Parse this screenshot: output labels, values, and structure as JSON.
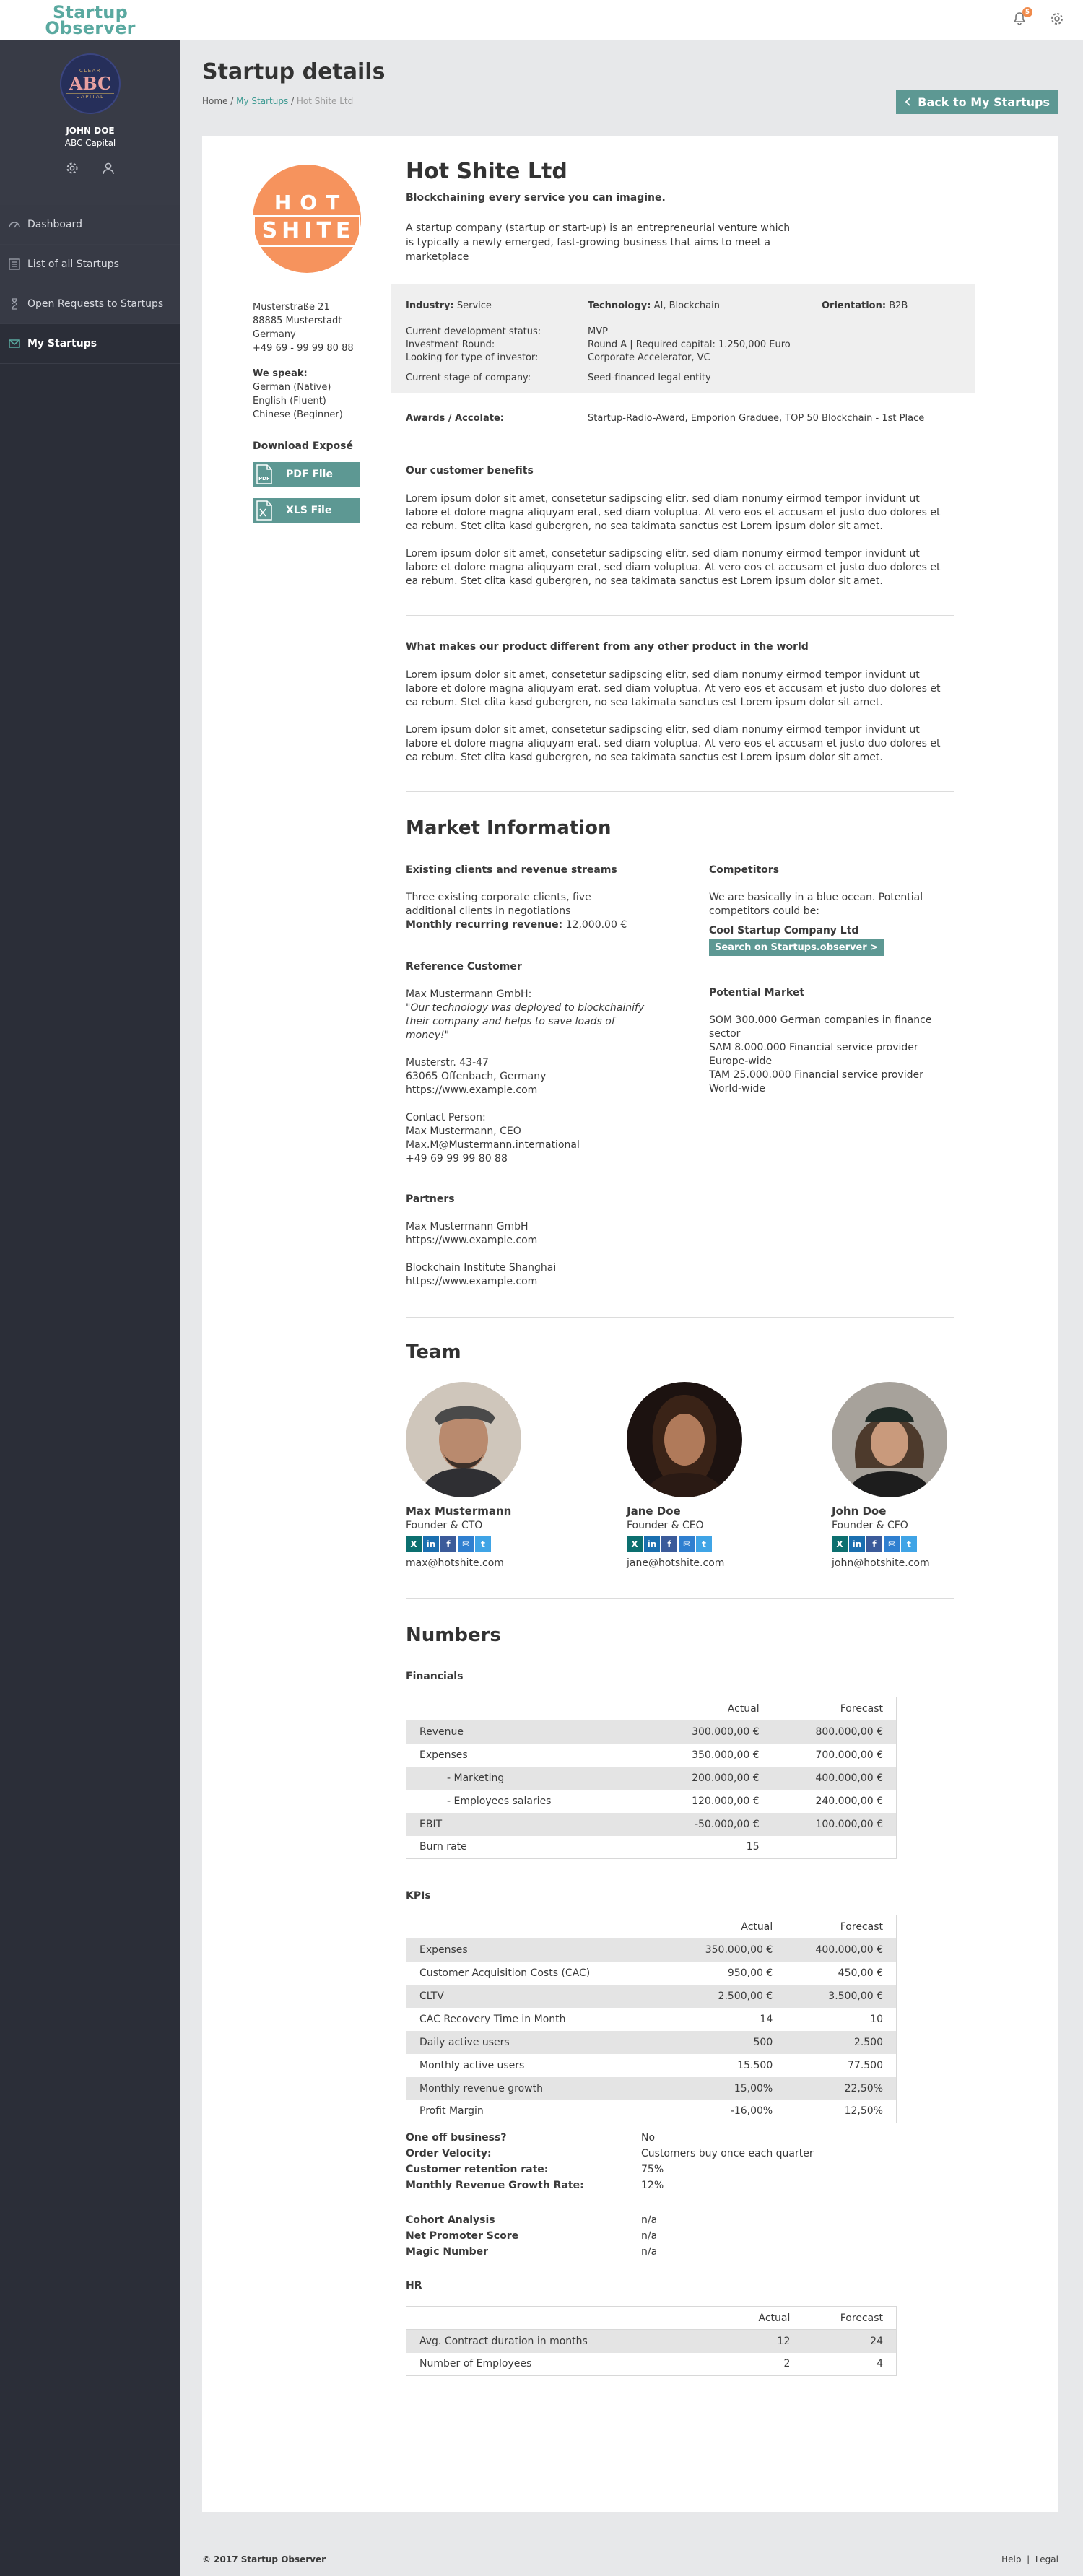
{
  "brand": {
    "line1": "Startup",
    "line2": "Observer"
  },
  "notifications": {
    "count": "5"
  },
  "profile": {
    "logo_top": "CLEAR",
    "logo_main": "ABC",
    "logo_bottom": "CAPITAL",
    "name": "JOHN DOE",
    "company": "ABC Capital"
  },
  "nav": [
    {
      "label": "Dashboard",
      "icon": "gauge-icon"
    },
    {
      "label": "List of all Startups",
      "icon": "list-icon"
    },
    {
      "label": "Open Requests to Startups",
      "icon": "hourglass-icon"
    },
    {
      "label": "My Startups",
      "icon": "envelope-icon"
    }
  ],
  "page": {
    "title": "Startup details",
    "back_label": "Back to My Startups"
  },
  "breadcrumb": {
    "home": "Home",
    "sep": "/",
    "mine": "My Startups",
    "current": "Hot Shite Ltd"
  },
  "company": {
    "logo_line1": "HOT",
    "logo_line2": "SHITE",
    "name": "Hot Shite Ltd",
    "tagline": "Blockchaining every service you can imagine.",
    "description": "A startup company (startup or start-up) is an entrepreneurial venture which is typically a newly emerged, fast-growing business that aims to meet a marketplace",
    "address": [
      "Musterstraße 21",
      "88885 Musterstadt",
      "Germany",
      "+49 69 - 99 99 80 88"
    ],
    "speak_label": "We speak:",
    "languages": [
      "German (Native)",
      "English (Fluent)",
      "Chinese (Beginner)"
    ],
    "download_title": "Download Exposé",
    "pdf_label": "PDF File",
    "xls_label": "XLS File"
  },
  "facts": {
    "industry_label": "Industry:",
    "industry": "Service",
    "technology_label": "Technology:",
    "technology": "AI, Blockchain",
    "orientation_label": "Orientation:",
    "orientation": "B2B",
    "dev_status_label": "Current development status:",
    "dev_status": "MVP",
    "investment_label": "Investment Round:",
    "investment": "Round A | Required capital: 1.250,000 Euro",
    "investor_label": "Looking for type of investor:",
    "investor": "Corporate Accelerator, VC",
    "stage_label": "Current stage of company:",
    "stage": "Seed-financed legal entity",
    "awards_label": "Awards / Accolate:",
    "awards": "Startup-Radio-Award, Emporion Graduee, TOP 50 Blockchain - 1st Place"
  },
  "benefits": {
    "title": "Our customer benefits",
    "p1": "Lorem ipsum dolor sit amet, consetetur sadipscing elitr, sed diam nonumy eirmod tempor invidunt ut labore et dolore magna aliquyam erat, sed diam voluptua. At vero eos et accusam et justo duo dolores et ea rebum. Stet clita kasd gubergren, no sea takimata sanctus est Lorem ipsum dolor sit amet.",
    "p2": "Lorem ipsum dolor sit amet, consetetur sadipscing elitr, sed diam nonumy eirmod tempor invidunt ut labore et dolore magna aliquyam erat, sed diam voluptua. At vero eos et accusam et justo duo dolores et ea rebum. Stet clita kasd gubergren, no sea takimata sanctus est Lorem ipsum dolor sit amet."
  },
  "difference": {
    "title": "What makes our product different from any other product in the world",
    "p1": "Lorem ipsum dolor sit amet, consetetur sadipscing elitr, sed diam nonumy eirmod tempor invidunt ut labore et dolore magna aliquyam erat, sed diam voluptua. At vero eos et accusam et justo duo dolores et ea rebum. Stet clita kasd gubergren, no sea takimata sanctus est Lorem ipsum dolor sit amet.",
    "p2": "Lorem ipsum dolor sit amet, consetetur sadipscing elitr, sed diam nonumy eirmod tempor invidunt ut labore et dolore magna aliquyam erat, sed diam voluptua. At vero eos et accusam et justo duo dolores et ea rebum. Stet clita kasd gubergren, no sea takimata sanctus est Lorem ipsum dolor sit amet."
  },
  "market": {
    "title": "Market Information",
    "clients_title": "Existing clients and revenue streams",
    "clients_text": "Three existing corporate clients, five additional clients in negotiations",
    "mrr_label": "Monthly recurring revenue:",
    "mrr": "12,000.00 €",
    "ref_title": "Reference Customer",
    "ref_company": "Max Mustermann GmbH:",
    "ref_quote": "\"Our technology was deployed to blockchainify their company and helps to save loads of money!\"",
    "ref_street": "Musterstr. 43-47",
    "ref_city": "63065 Offenbach, Germany",
    "ref_url": "https://www.example.com",
    "contact_label": "Contact Person:",
    "contact_name": "Max Mustermann, CEO",
    "contact_email": "Max.M@Mustermann.international",
    "contact_phone": "+49 69 99 99 80 88",
    "partners_title": "Partners",
    "partner1_name": "Max Mustermann GmbH",
    "partner1_url": "https://www.example.com",
    "partner2_name": "Blockchain Institute Shanghai",
    "partner2_url": "https://www.example.com",
    "competitors_title": "Competitors",
    "competitors_text": "We are basically in a blue ocean. Potential competitors could be:",
    "competitor1": "Cool Startup Company Ltd",
    "search_label": "Search on Startups.observer >",
    "potential_title": "Potential Market",
    "som": "SOM 300.000 German companies in finance sector",
    "sam": "SAM 8.000.000 Financial service provider Europe-wide",
    "tam": "TAM 25.000.000 Financial service provider World-wide"
  },
  "team": {
    "title": "Team",
    "members": [
      {
        "name": "Max Mustermann",
        "role": "Founder & CTO",
        "email": "max@hotshite.com"
      },
      {
        "name": "Jane Doe",
        "role": "Founder & CEO",
        "email": "jane@hotshite.com"
      },
      {
        "name": "John Doe",
        "role": "Founder & CFO",
        "email": "john@hotshite.com"
      }
    ]
  },
  "numbers": {
    "title": "Numbers",
    "col_actual": "Actual",
    "col_forecast": "Forecast",
    "financials_title": "Financials",
    "financials": [
      [
        "Revenue",
        "300.000,00 €",
        "800.000,00 €"
      ],
      [
        "Expenses",
        "350.000,00 €",
        "700.000,00 €"
      ],
      [
        "- Marketing",
        "200.000,00 €",
        "400.000,00 €"
      ],
      [
        "- Employees salaries",
        "120.000,00 €",
        "240.000,00 €"
      ],
      [
        "EBIT",
        "-50.000,00 €",
        "100.000,00 €"
      ],
      [
        "Burn rate",
        "15",
        ""
      ]
    ],
    "kpis_title": "KPIs",
    "kpis": [
      [
        "Expenses",
        "350.000,00 €",
        "400.000,00 €"
      ],
      [
        "Customer Acquisition Costs (CAC)",
        "950,00 €",
        "450,00 €"
      ],
      [
        "CLTV",
        "2.500,00 €",
        "3.500,00 €"
      ],
      [
        "CAC Recovery Time in Month",
        "14",
        "10"
      ],
      [
        "Daily active users",
        "500",
        "2.500"
      ],
      [
        "Monthly active users",
        "15.500",
        "77.500"
      ],
      [
        "Monthly revenue growth",
        "15,00%",
        "22,50%"
      ],
      [
        "Profit Margin",
        "-16,00%",
        "12,50%"
      ]
    ],
    "kv1": [
      [
        "One off business?",
        "No"
      ],
      [
        "Order Velocity:",
        "Customers buy once each quarter"
      ],
      [
        "Customer retention rate:",
        "75%"
      ],
      [
        "Monthly Revenue Growth Rate:",
        "12%"
      ]
    ],
    "kv2": [
      [
        "Cohort Analysis",
        "n/a"
      ],
      [
        "Net Promoter Score",
        "n/a"
      ],
      [
        "Magic Number",
        "n/a"
      ]
    ],
    "hr_title": "HR",
    "hr": [
      [
        "Avg. Contract duration in months",
        "12",
        "24"
      ],
      [
        "Number of Employees",
        "2",
        "4"
      ]
    ]
  },
  "footer": {
    "copyright": "© 2017 Startup Observer",
    "help": "Help",
    "sep": "|",
    "legal": "Legal"
  },
  "colors": {
    "accent": "#5d9893",
    "brand": "#5aa9a0",
    "logo_orange": "#f6935d",
    "sidebar": "#2b2e38"
  }
}
